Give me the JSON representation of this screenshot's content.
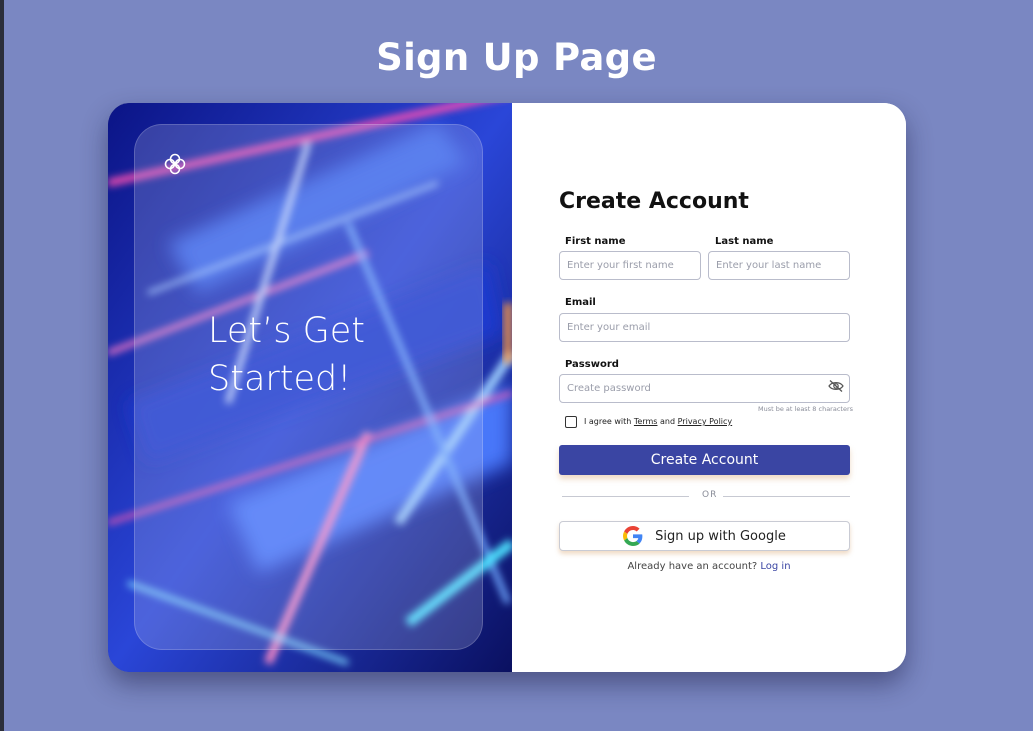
{
  "page": {
    "title": "Sign Up Page",
    "background": "#7a87c2"
  },
  "hero": {
    "tagline_line1": "Let’s Get",
    "tagline_line2": "Started!",
    "logo_icon": "flower-logo-icon"
  },
  "form": {
    "title": "Create Account",
    "first_name": {
      "label": "First name",
      "placeholder": "Enter your first name"
    },
    "last_name": {
      "label": "Last name",
      "placeholder": "Enter your last name"
    },
    "email": {
      "label": "Email",
      "placeholder": "Enter your email"
    },
    "password": {
      "label": "Password",
      "placeholder": "Create password",
      "hint": "Must be at least 8 characters",
      "toggle_icon": "eye-off-icon"
    },
    "agree": {
      "prefix": "I agree with",
      "terms": "Terms",
      "and": "and",
      "privacy": "Privacy Policy"
    },
    "submit_label": "Create Account",
    "divider_text": "OR",
    "google_label": "Sign up with Google",
    "login_prompt": "Already have an account?",
    "login_link": "Log in",
    "accent": "#3a45a3"
  }
}
